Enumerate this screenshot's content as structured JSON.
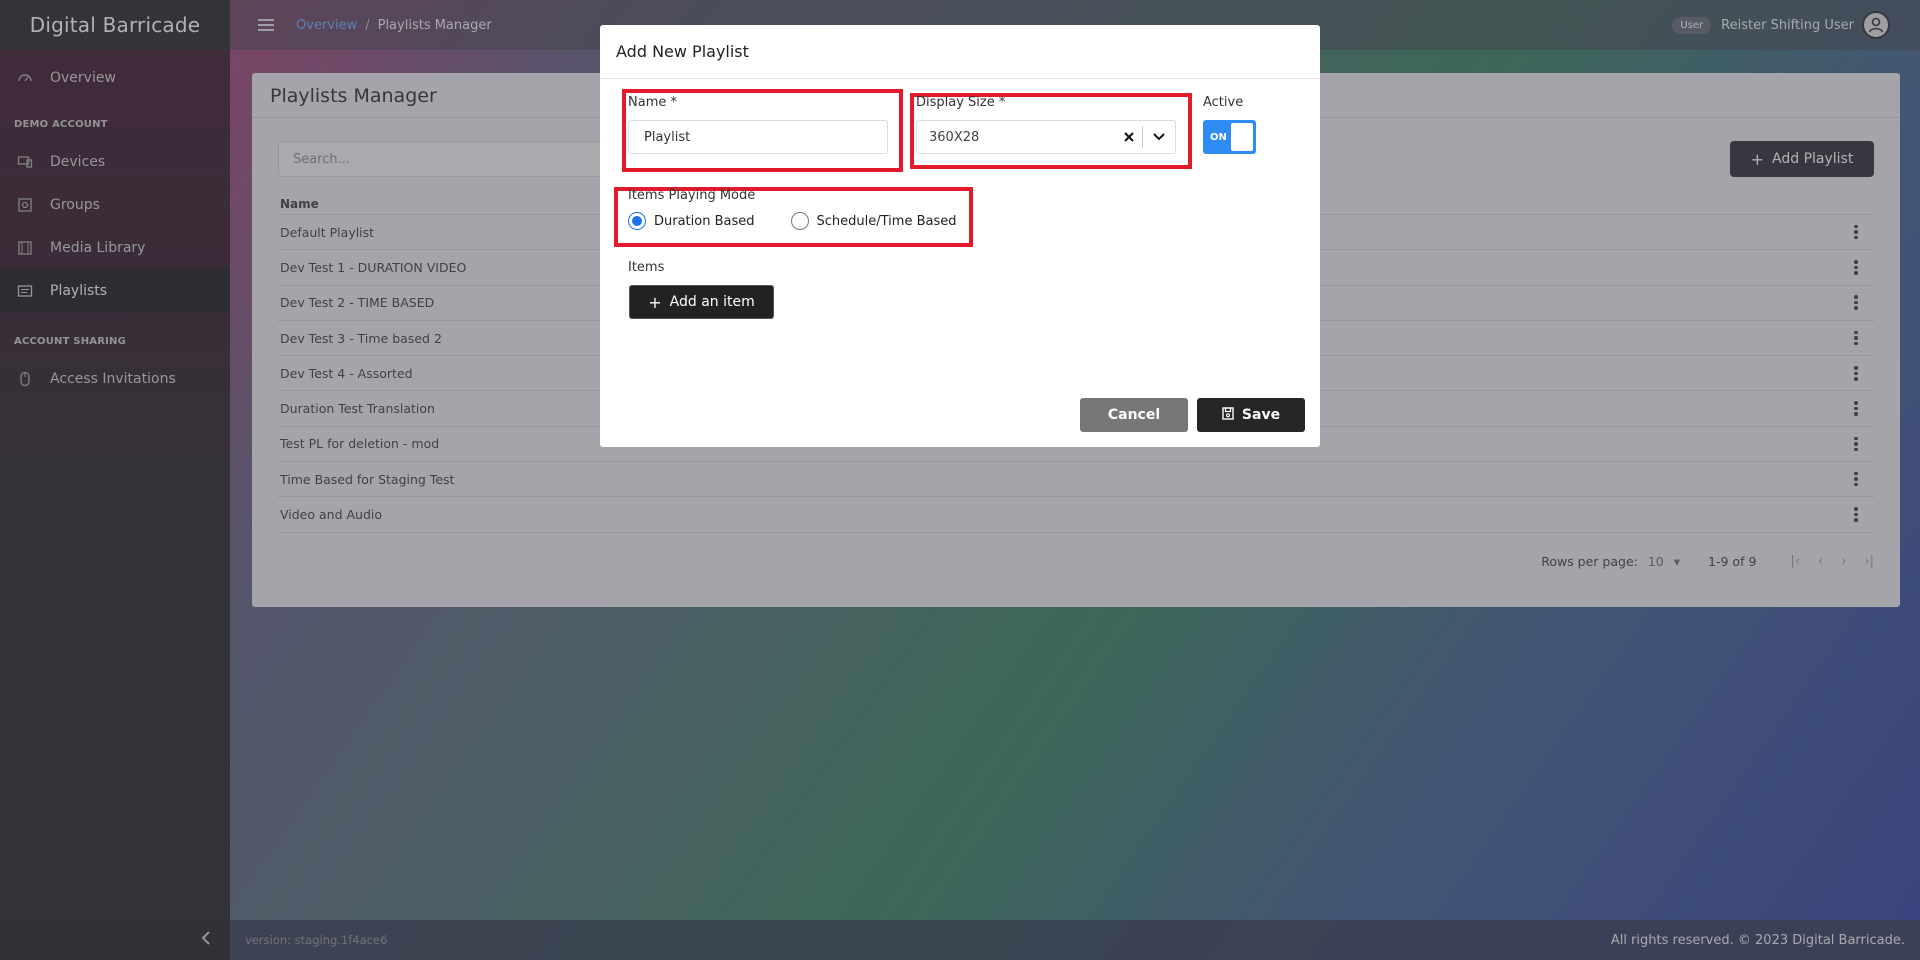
{
  "sidebar": {
    "brand": "Digital Barricade",
    "overview": "Overview",
    "section_demo": "DEMO ACCOUNT",
    "items": [
      {
        "label": "Devices"
      },
      {
        "label": "Groups"
      },
      {
        "label": "Media Library"
      },
      {
        "label": "Playlists"
      }
    ],
    "section_sharing": "ACCOUNT SHARING",
    "access_invitations": "Access Invitations"
  },
  "topbar": {
    "breadcrumb_link": "Overview",
    "breadcrumb_sep": "/",
    "breadcrumb_current": "Playlists Manager",
    "user_badge": "User",
    "user_name": "Reister Shifting User"
  },
  "page": {
    "title": "Playlists Manager",
    "search_placeholder": "Search...",
    "add_button": "Add Playlist",
    "column_name": "Name",
    "rows": [
      "Default Playlist",
      "Dev Test 1 - DURATION VIDEO",
      "Dev Test 2 - TIME BASED",
      "Dev Test 3 - Time based 2",
      "Dev Test 4 - Assorted",
      "Duration Test Translation",
      "Test PL for deletion - mod",
      "Time Based for Staging Test",
      "Video and Audio"
    ],
    "rows_per_page_label": "Rows per page:",
    "rows_per_page_value": "10",
    "range": "1-9 of 9"
  },
  "footer": {
    "version": "version: staging.1f4ace6",
    "copyright": "All rights reserved. © 2023 Digital Barricade."
  },
  "modal": {
    "title": "Add New Playlist",
    "name_label": "Name *",
    "name_value": "Playlist",
    "display_size_label": "Display Size *",
    "display_size_value": "360X28",
    "active_label": "Active",
    "active_toggle_text": "ON",
    "mode_label": "Items Playing Mode",
    "mode_duration": "Duration Based",
    "mode_schedule": "Schedule/Time Based",
    "items_label": "Items",
    "add_item_button": "Add an item",
    "cancel_button": "Cancel",
    "save_button": "Save"
  },
  "colors": {
    "highlight": "#e11b2b",
    "toggle_on": "#2f8cf5",
    "link": "#6aa7ff"
  }
}
